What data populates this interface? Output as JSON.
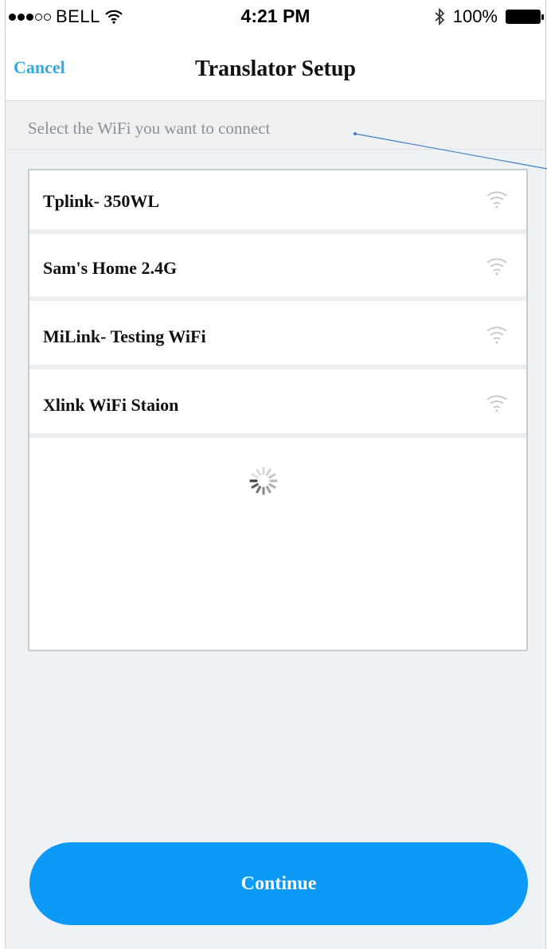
{
  "status_bar": {
    "carrier": "BELL",
    "time": "4:21 PM",
    "battery": "100%"
  },
  "nav": {
    "cancel_label": "Cancel",
    "title": "Translator Setup"
  },
  "subheader": {
    "text": "Select the WiFi you want to connect"
  },
  "wifi_list": [
    {
      "name": "Tplink- 350WL",
      "icon": "wifi-icon"
    },
    {
      "name": "Sam's Home 2.4G",
      "icon": "wifi-icon"
    },
    {
      "name": "MiLink- Testing WiFi",
      "icon": "wifi-icon"
    },
    {
      "name": "Xlink WiFi Staion",
      "icon": "wifi-icon"
    }
  ],
  "loading_indicator": {
    "icon": "spinner-icon"
  },
  "continue_button": {
    "label": "Continue"
  },
  "colors": {
    "accent": "#0b9af7",
    "link": "#35a8e6",
    "background": "#eff2f5"
  }
}
